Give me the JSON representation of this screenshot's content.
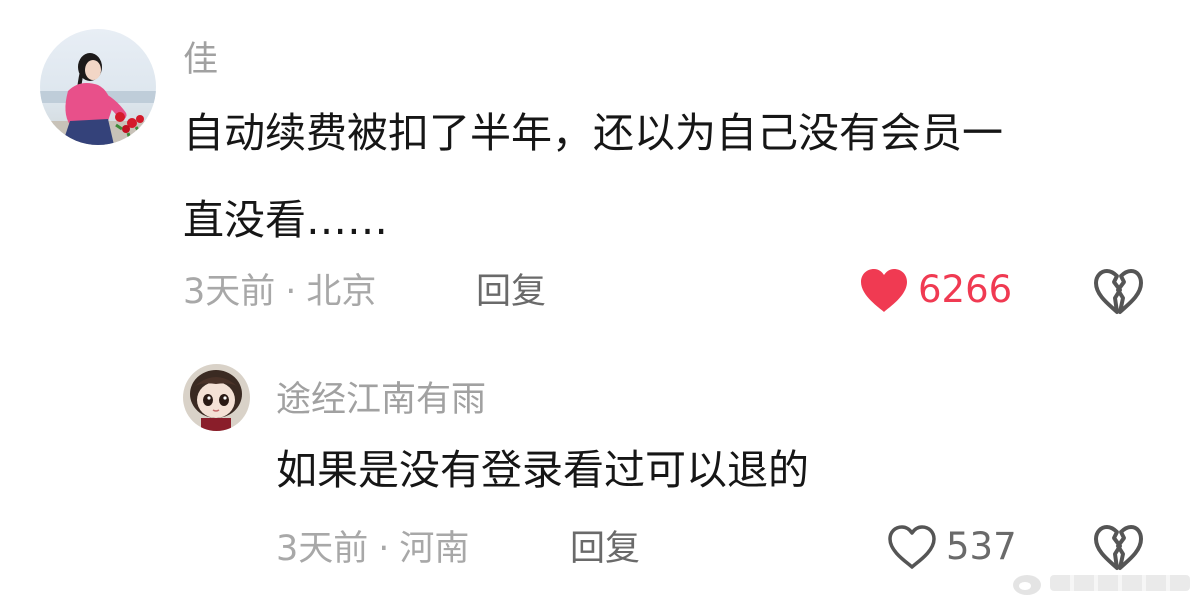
{
  "comment": {
    "username": "佳",
    "text_line1": "自动续费被扣了半年，还以为自己没有会员一",
    "text_line2": "直没看……",
    "time": "3天前",
    "location": "北京",
    "separator": "·",
    "reply_label": "回复",
    "like_count": "6266",
    "liked": true,
    "like_icon": "heart-filled-icon",
    "dislike_icon": "broken-heart-icon"
  },
  "reply": {
    "username": "途经江南有雨",
    "text": "如果是没有登录看过可以退的",
    "time": "3天前",
    "location": "河南",
    "separator": "·",
    "reply_label": "回复",
    "like_count": "537",
    "liked": false,
    "like_icon": "heart-outline-icon",
    "dislike_icon": "broken-heart-icon"
  },
  "colors": {
    "like_active": "#f03a52",
    "meta_text": "#a8a8a8",
    "comment_text": "#161616"
  }
}
